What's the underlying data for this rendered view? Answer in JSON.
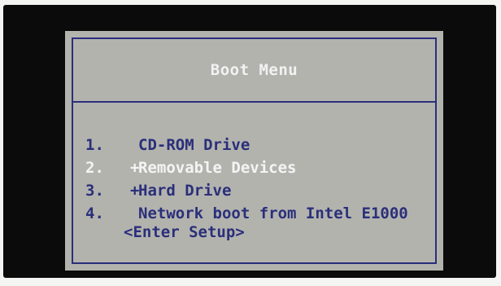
{
  "boot_menu": {
    "title": "Boot Menu",
    "items": [
      {
        "number": "1.",
        "marker": "",
        "label": "CD-ROM Drive"
      },
      {
        "number": "2.",
        "marker": "+",
        "label": "Removable Devices"
      },
      {
        "number": "3.",
        "marker": "+",
        "label": "Hard Drive"
      },
      {
        "number": "4.",
        "marker": "",
        "label": "Network boot from Intel E1000"
      }
    ],
    "enter_setup": "<Enter Setup>"
  },
  "colors": {
    "screen_background": "#b3b3ae",
    "text_blue": "#2a2f7a",
    "selected_text": "#f4f4f4",
    "bezel": "#0b0b0c"
  }
}
